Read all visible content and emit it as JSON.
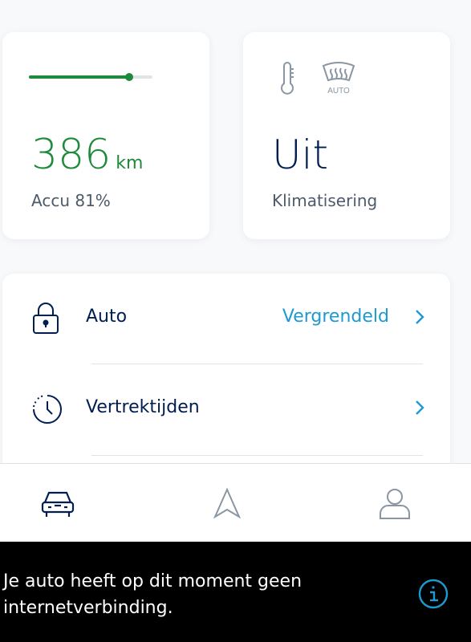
{
  "battery": {
    "range_value": "386",
    "range_unit": "km",
    "charge_label": "Accu 81%",
    "charge_level": 0.81,
    "accent_color": "#208a3c"
  },
  "climate": {
    "status_value": "Uit",
    "label": "Klimatisering",
    "defrost_badge": "AUTO",
    "icons": [
      "thermometer-icon",
      "defrost-auto-icon"
    ]
  },
  "list": {
    "items": [
      {
        "icon": "lock-icon",
        "label": "Auto",
        "status": "Vergrendeld",
        "status_color": "#1c9ad1"
      },
      {
        "icon": "timer-icon",
        "label": "Vertrektijden",
        "status": ""
      }
    ]
  },
  "nav": {
    "items": [
      {
        "icon": "car-icon",
        "active": true
      },
      {
        "icon": "navigation-arrow-icon",
        "active": false
      },
      {
        "icon": "profile-icon",
        "active": false
      }
    ]
  },
  "toast": {
    "message": "Je auto heeft op dit moment geen internetverbinding.",
    "icon": "info-icon",
    "accent_color": "#1c9ad1"
  }
}
